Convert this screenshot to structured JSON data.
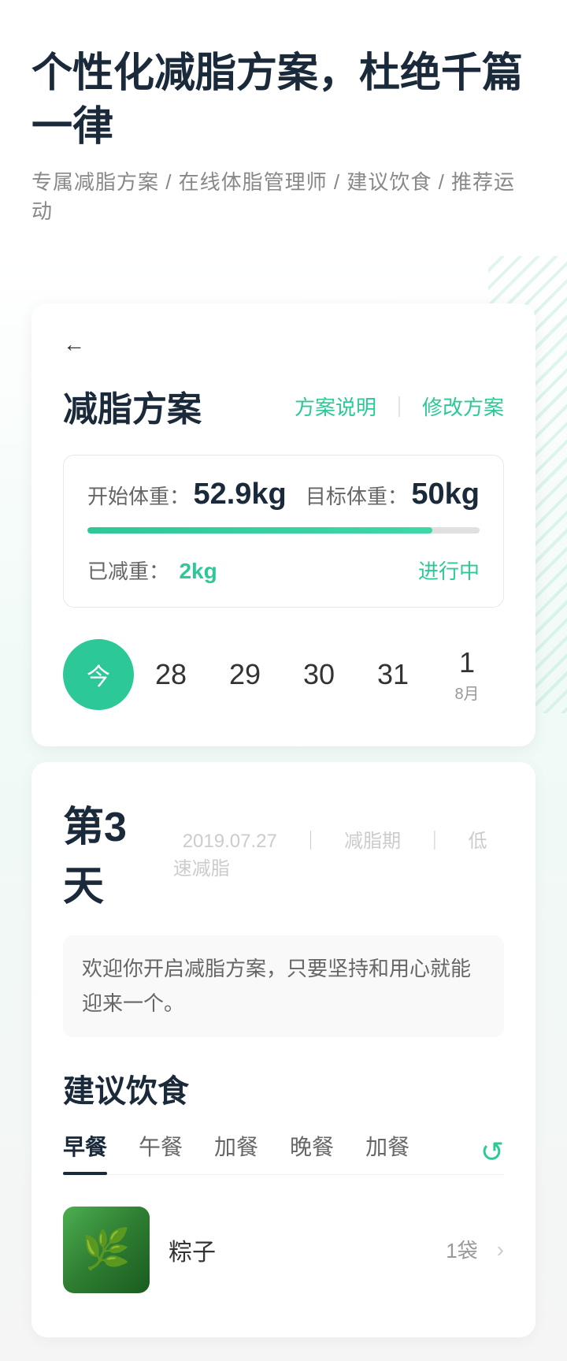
{
  "header": {
    "main_title": "个性化减脂方案，杜绝千篇一律",
    "sub_title": "专属减脂方案 / 在线体脂管理师 / 建议饮食 / 推荐运动"
  },
  "card": {
    "back_icon": "←",
    "title": "减脂方案",
    "action_explain": "方案说明",
    "action_divider": "｜",
    "action_modify": "修改方案",
    "weight_info": {
      "start_label": "开始体重：",
      "start_value": "52.9kg",
      "target_label": "目标体重：",
      "target_value": "50kg",
      "progress_percent": 88,
      "lost_label": "已减重：",
      "lost_value": "2kg",
      "status": "进行中"
    }
  },
  "date_selector": {
    "items": [
      {
        "label": "今",
        "sub": "",
        "active": true
      },
      {
        "label": "28",
        "sub": "",
        "active": false
      },
      {
        "label": "29",
        "sub": "",
        "active": false
      },
      {
        "label": "30",
        "sub": "",
        "active": false
      },
      {
        "label": "31",
        "sub": "",
        "active": false
      },
      {
        "label": "1",
        "sub": "8月",
        "active": false
      }
    ]
  },
  "day_section": {
    "day_number": "第3天",
    "date": "2019.07.27",
    "separator1": "｜",
    "phase": "减脂期",
    "separator2": "｜",
    "phase_type": "低速减脂",
    "message": "欢迎你开启减脂方案，只要坚持和用心就能迎来一个。"
  },
  "diet": {
    "title": "建议饮食",
    "tabs": [
      {
        "label": "早餐",
        "active": true
      },
      {
        "label": "午餐",
        "active": false
      },
      {
        "label": "加餐",
        "active": false
      },
      {
        "label": "晚餐",
        "active": false
      },
      {
        "label": "加餐",
        "active": false
      }
    ],
    "refresh_icon": "↺",
    "food_items": [
      {
        "name": "粽子",
        "amount": "1袋",
        "image_emoji": "🌿"
      }
    ]
  }
}
